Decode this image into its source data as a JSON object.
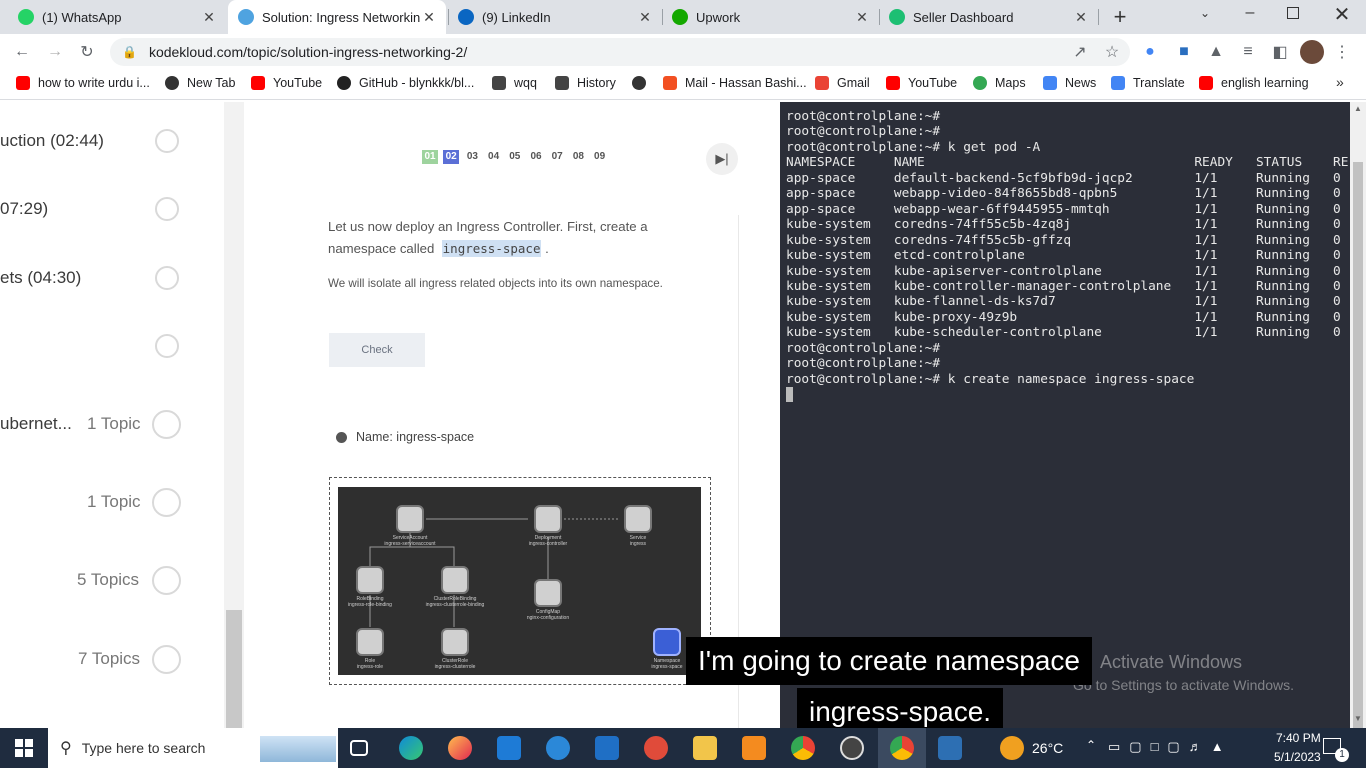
{
  "tabs": [
    {
      "title": "(1) WhatsApp",
      "icon": "whatsapp-icon",
      "color": "#25d366",
      "active": false
    },
    {
      "title": "Solution: Ingress Networking",
      "icon": "kodekloud-icon",
      "color": "#4fa3e0",
      "active": true
    },
    {
      "title": "(9) LinkedIn",
      "icon": "linkedin-icon",
      "color": "#0a66c2",
      "active": false
    },
    {
      "title": "Upwork",
      "icon": "upwork-icon",
      "color": "#14a800",
      "active": false
    },
    {
      "title": "Seller Dashboard",
      "icon": "seller-dashboard-icon",
      "color": "#1dbf73",
      "active": false
    }
  ],
  "address": {
    "url": "kodekloud.com/topic/solution-ingress-networking-2/"
  },
  "bookmarks": [
    {
      "label": "how to write urdu i...",
      "icon": "youtube-icon",
      "color": "#ff0000"
    },
    {
      "label": "New Tab",
      "icon": "globe-icon",
      "color": "#333333"
    },
    {
      "label": "YouTube",
      "icon": "youtube-icon",
      "color": "#ff0000"
    },
    {
      "label": "GitHub - blynkkk/bl...",
      "icon": "github-icon",
      "color": "#222222"
    },
    {
      "label": "wqq",
      "icon": "download-icon",
      "color": "#444444"
    },
    {
      "label": "History",
      "icon": "history-icon",
      "color": "#444444"
    },
    {
      "label": "",
      "icon": "globe-icon",
      "color": "#333333"
    },
    {
      "label": "Mail - Hassan Bashi...",
      "icon": "microsoft-icon",
      "color": "#f25022"
    },
    {
      "label": "Gmail",
      "icon": "gmail-icon",
      "color": "#ea4335"
    },
    {
      "label": "YouTube",
      "icon": "youtube-icon",
      "color": "#ff0000"
    },
    {
      "label": "Maps",
      "icon": "maps-icon",
      "color": "#34a853"
    },
    {
      "label": "News",
      "icon": "news-icon",
      "color": "#4285f4"
    },
    {
      "label": "Translate",
      "icon": "translate-icon",
      "color": "#4285f4"
    },
    {
      "label": "english learning",
      "icon": "youtube-icon",
      "color": "#ff0000"
    }
  ],
  "sidebar": {
    "items": [
      {
        "text": "uction (02:44)",
        "topics": ""
      },
      {
        "text": "07:29)",
        "topics": ""
      },
      {
        "text": "ets (04:30)",
        "topics": ""
      },
      {
        "text": "",
        "topics": ""
      },
      {
        "text": "ubernet...",
        "topics": "1 Topic"
      },
      {
        "text": "",
        "topics": "1 Topic"
      },
      {
        "text": "",
        "topics": "5 Topics"
      },
      {
        "text": "",
        "topics": "7 Topics"
      }
    ]
  },
  "lesson": {
    "steps": [
      {
        "label": "01",
        "state": "done"
      },
      {
        "label": "02",
        "state": "current"
      },
      {
        "label": "03",
        "state": "todo"
      },
      {
        "label": "04",
        "state": "todo"
      },
      {
        "label": "05",
        "state": "todo"
      },
      {
        "label": "06",
        "state": "todo"
      },
      {
        "label": "07",
        "state": "todo"
      },
      {
        "label": "08",
        "state": "todo"
      },
      {
        "label": "09",
        "state": "todo"
      }
    ],
    "instruction_a": "Let us now deploy an Ingress Controller. First, create a",
    "instruction_b": "namespace called",
    "code": "ingress-space",
    "instruction_end": ".",
    "note": "We will isolate all ingress related objects into its own namespace.",
    "check_label": "Check",
    "bullet": "Name: ingress-space",
    "diagram": {
      "nodes": [
        {
          "title": "ServiceAccount",
          "sub": "ingress-serviceaccount"
        },
        {
          "title": "Deployment",
          "sub": "ingress-controller"
        },
        {
          "title": "Service",
          "sub": "ingress"
        },
        {
          "title": "RoleBinding",
          "sub": "ingress-role-binding"
        },
        {
          "title": "ClusterRoleBinding",
          "sub": "ingress-clusterrole-binding"
        },
        {
          "title": "ConfigMap",
          "sub": "nginx-configuration"
        },
        {
          "title": "Role",
          "sub": "ingress-role"
        },
        {
          "title": "ClusterRole",
          "sub": "ingress-clusterrole"
        },
        {
          "title": "Namespace",
          "sub": "ingress-space"
        }
      ]
    }
  },
  "terminal": {
    "lines": [
      "root@controlplane:~#",
      "root@controlplane:~#",
      "root@controlplane:~# k get pod -A",
      "NAMESPACE     NAME                                   READY   STATUS    RE",
      "app-space     default-backend-5cf9bfb9d-jqcp2        1/1     Running   0",
      "app-space     webapp-video-84f8655bd8-qpbn5          1/1     Running   0",
      "app-space     webapp-wear-6ff9445955-mmtqh           1/1     Running   0",
      "kube-system   coredns-74ff55c5b-4zq8j                1/1     Running   0",
      "kube-system   coredns-74ff55c5b-gffzq                1/1     Running   0",
      "kube-system   etcd-controlplane                      1/1     Running   0",
      "kube-system   kube-apiserver-controlplane            1/1     Running   0",
      "kube-system   kube-controller-manager-controlplane   1/1     Running   0",
      "kube-system   kube-flannel-ds-ks7d7                  1/1     Running   0",
      "kube-system   kube-proxy-49z9b                       1/1     Running   0",
      "kube-system   kube-scheduler-controlplane            1/1     Running   0",
      "root@controlplane:~#",
      "root@controlplane:~#",
      "root@controlplane:~# k create namespace ingress-space"
    ]
  },
  "captions": {
    "line1": "I'm going to create namespace",
    "line2": "ingress-space."
  },
  "watermark": {
    "title": "Activate Windows",
    "sub": "Go to Settings to activate Windows."
  },
  "taskbar": {
    "search_placeholder": "Type here to search",
    "weather": "26°C",
    "time": "7:40 PM",
    "date": "5/1/2023",
    "notifications": "1"
  }
}
